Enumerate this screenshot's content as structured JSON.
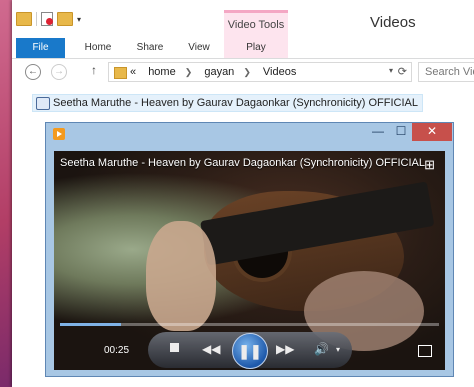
{
  "window": {
    "title": "Videos",
    "context_tab_group": "Video Tools"
  },
  "ribbon": {
    "tabs": [
      "File",
      "Home",
      "Share",
      "View",
      "Play"
    ]
  },
  "address": {
    "crumbs": [
      "home",
      "gayan",
      "Videos"
    ],
    "overflow": "«",
    "search_placeholder": "Search Videos"
  },
  "file": {
    "name": "Seetha Maruthe - Heaven by Gaurav Dagaonkar (Synchronicity) OFFICIAL"
  },
  "player": {
    "video_title": "Seetha Maruthe - Heaven by Gaurav Dagaonkar (Synchronicity) OFFICIAL",
    "elapsed": "00:25",
    "progress": 0.16,
    "play_icon": "pause-icon",
    "accent": "#1f5fb8"
  },
  "icons": {
    "back": "←",
    "forward": "→",
    "up": "↑",
    "refresh": "⟳",
    "stop": "",
    "prev": "◀◀",
    "pause": "❚❚",
    "next": "▶▶",
    "volume": "🔊",
    "dropdown": "▾",
    "minimize": "—",
    "maximize": "☐",
    "close": "✕",
    "layout": "⊞"
  }
}
